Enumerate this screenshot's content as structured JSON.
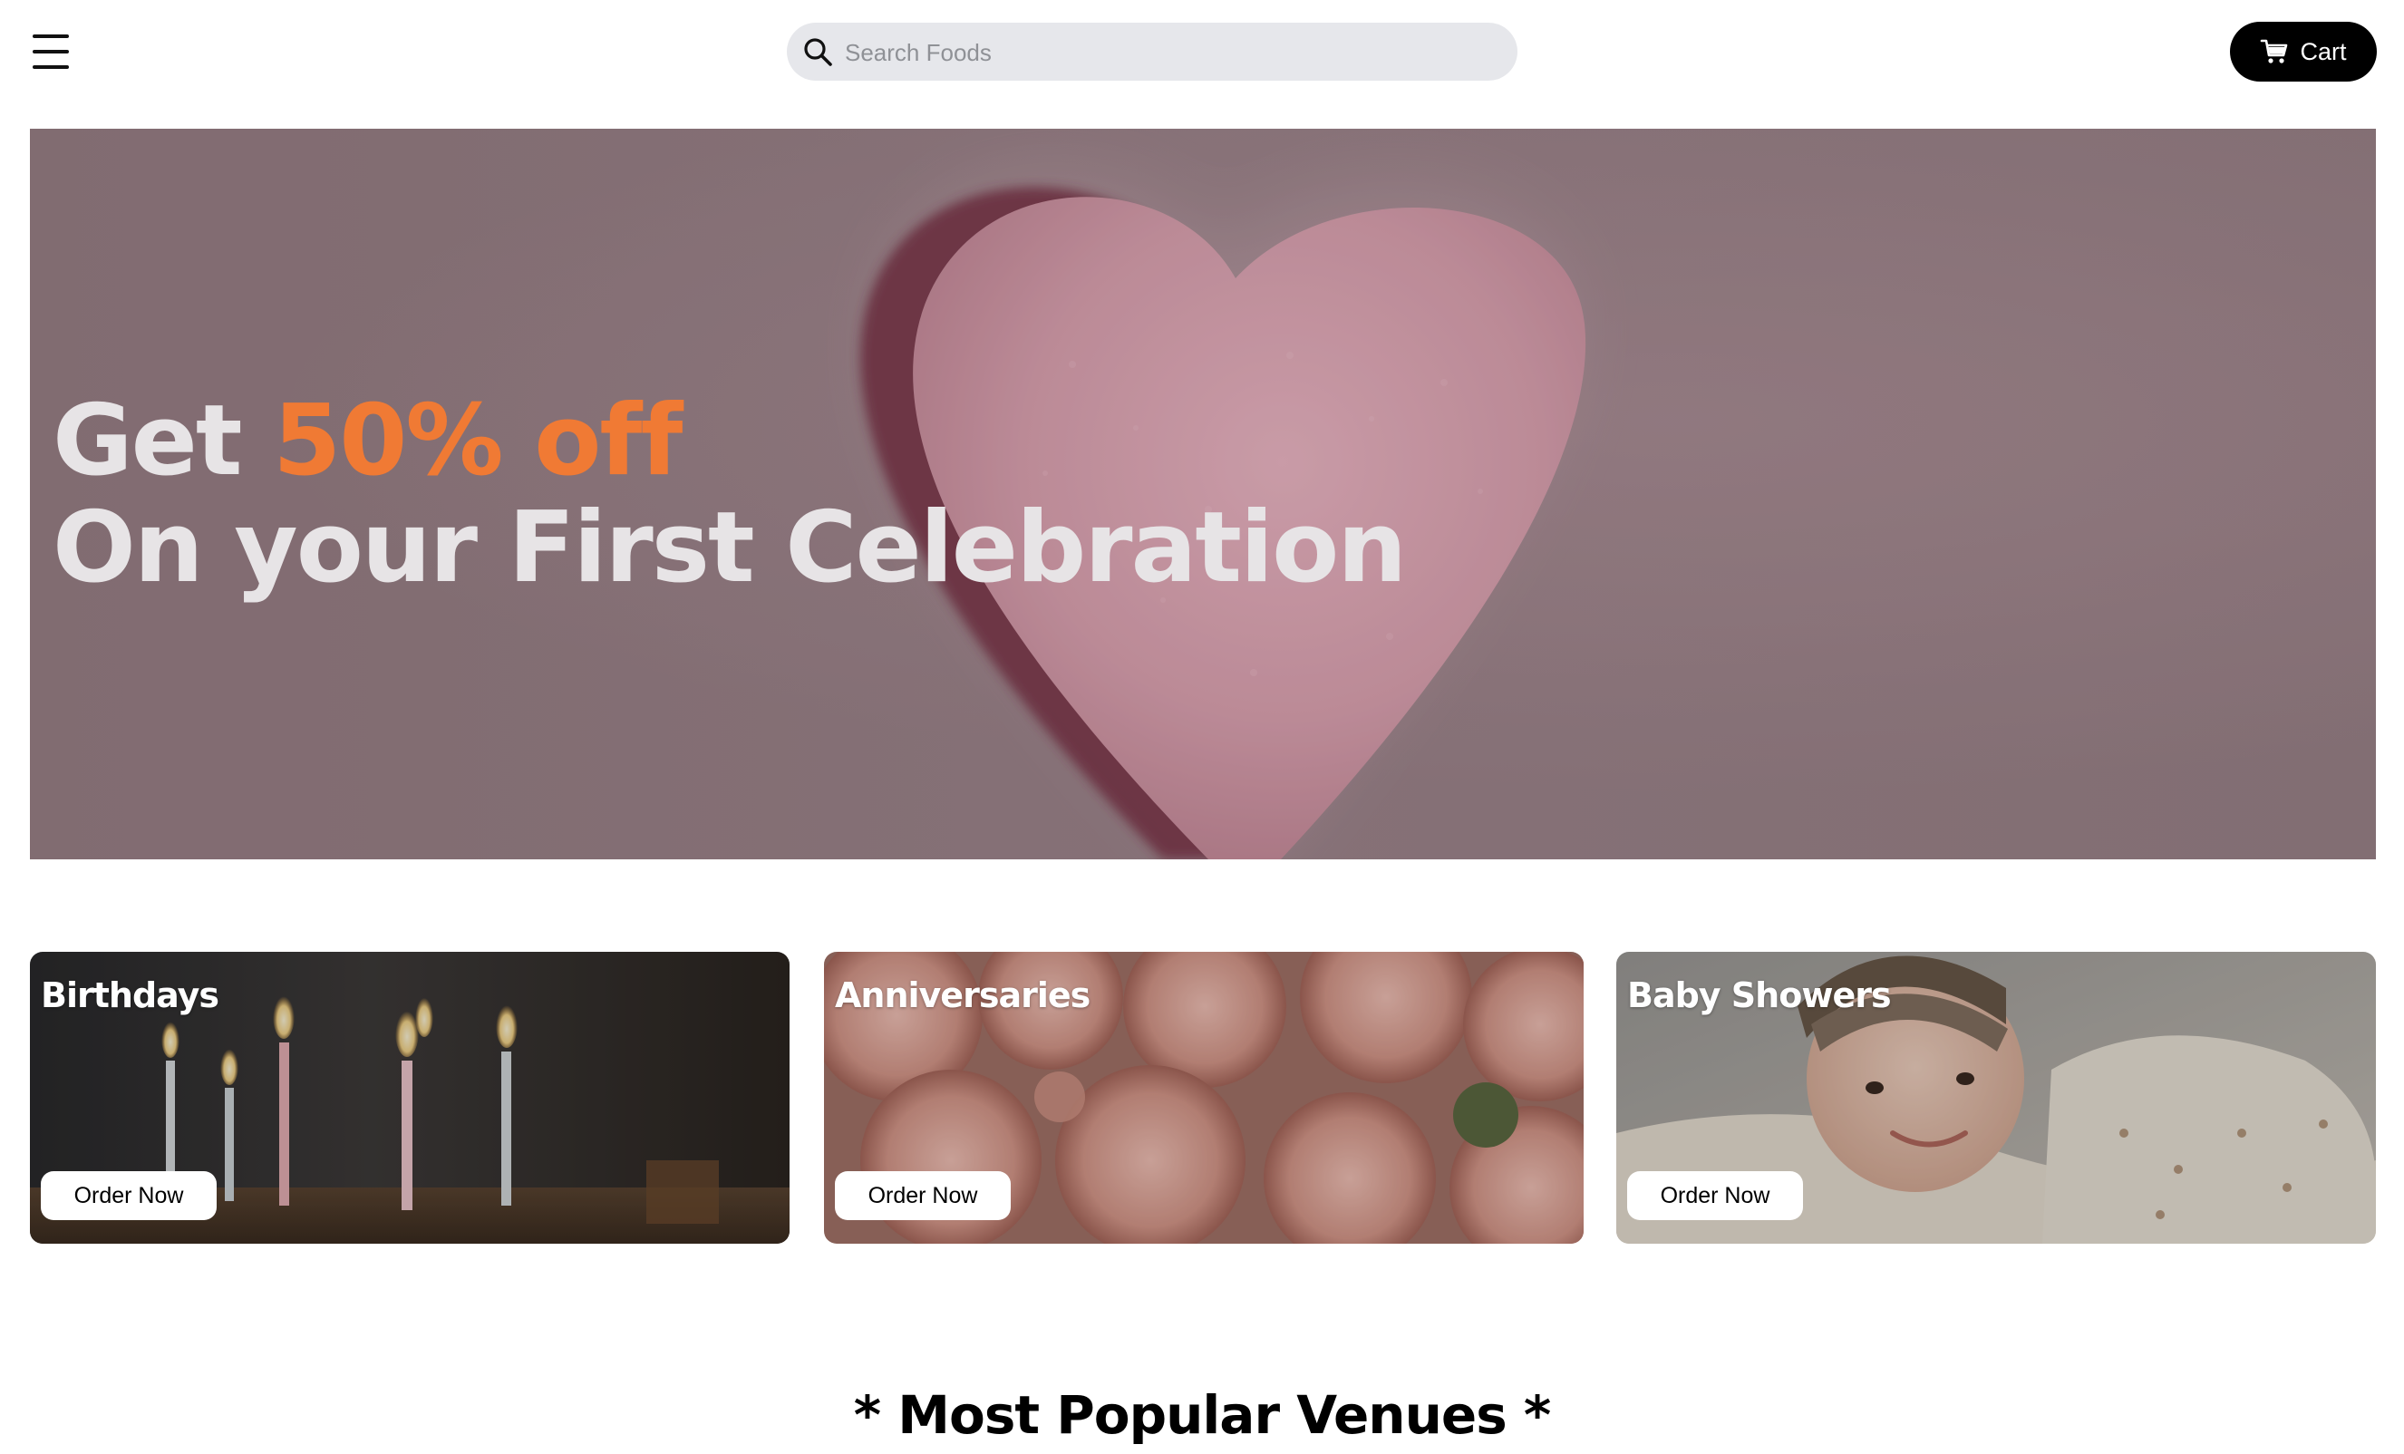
{
  "header": {
    "search": {
      "placeholder": "Search Foods",
      "value": ""
    },
    "cart_label": "Cart",
    "icons": {
      "menu": "hamburger-menu-icon",
      "search": "search-icon",
      "cart": "cart-icon"
    }
  },
  "hero": {
    "line1_prefix": "Get ",
    "line1_accent": "50% off",
    "line2": "On your First Celebration",
    "colors": {
      "text": "#e7e4e6",
      "accent": "#f07a34",
      "background": "#8d777d",
      "heart": "#d9a2b0"
    }
  },
  "categories": [
    {
      "title": "Birthdays",
      "button": "Order Now"
    },
    {
      "title": "Anniversaries",
      "button": "Order Now"
    },
    {
      "title": "Baby Showers",
      "button": "Order Now"
    }
  ],
  "section": {
    "heading": "* Most Popular Venues *"
  },
  "theme": {
    "primary": "#000000",
    "search_bg": "#e6e7eb"
  }
}
